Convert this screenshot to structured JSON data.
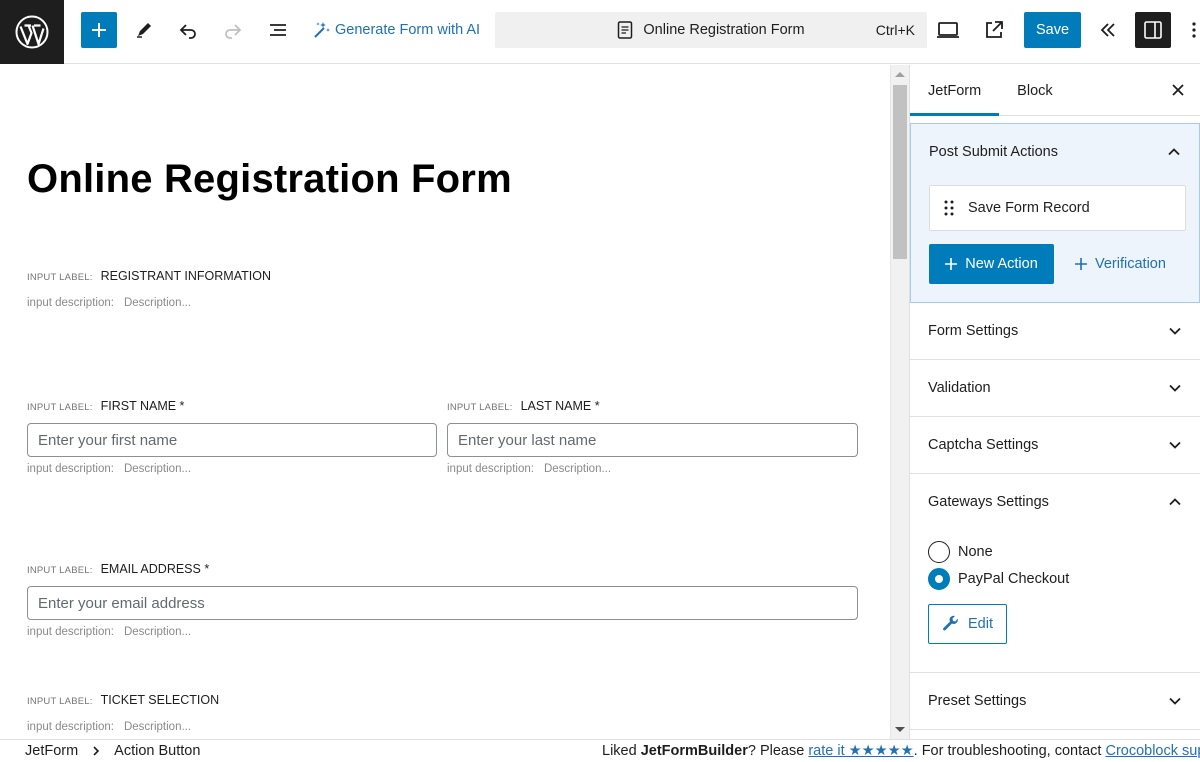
{
  "toolbar": {
    "generate_ai_label": "Generate Form with AI",
    "document_title": "Online Registration Form",
    "shortcut": "Ctrl+K",
    "save_label": "Save",
    "icons": [
      "wordpress-icon",
      "plus-icon",
      "pen-icon",
      "undo-icon",
      "redo-icon",
      "list-view-icon",
      "magic-wand-icon",
      "document-icon",
      "desktop-icon",
      "external-link-icon",
      "collapse-icon",
      "sidebar-icon",
      "more-icon"
    ]
  },
  "canvas": {
    "title": "Online Registration Form",
    "input_label_prefix": "INPUT LABEL:",
    "description_prefix": "input description:",
    "description_placeholder": "Description...",
    "fields": {
      "registrant": {
        "label": "REGISTRANT INFORMATION"
      },
      "first_name": {
        "label": "FIRST NAME *",
        "placeholder": "Enter your first name"
      },
      "last_name": {
        "label": "LAST NAME *",
        "placeholder": "Enter your last name"
      },
      "email": {
        "label": "EMAIL ADDRESS *",
        "placeholder": "Enter your email address"
      },
      "ticket": {
        "label": "TICKET SELECTION"
      }
    }
  },
  "sidebar": {
    "tabs": [
      "JetForm",
      "Block"
    ],
    "active_tab": "JetForm",
    "post_submit": {
      "title": "Post Submit Actions",
      "action_card": "Save Form Record",
      "new_action": "New Action",
      "verification": "Verification"
    },
    "sections": {
      "form_settings": "Form Settings",
      "validation": "Validation",
      "captcha": "Captcha Settings",
      "gateways": "Gateways Settings",
      "preset": "Preset Settings"
    },
    "gateways": {
      "options": [
        "None",
        "PayPal Checkout"
      ],
      "selected": "PayPal Checkout",
      "edit_label": "Edit"
    }
  },
  "footer": {
    "crumb_1": "JetForm",
    "crumb_2": "Action Button",
    "promo_prefix": "Liked ",
    "promo_brand": "JetFormBuilder",
    "promo_mid": "? Please ",
    "promo_link": "rate it ★★★★★",
    "promo_after": ". For troubleshooting, contact ",
    "promo_support": "Crocoblock supp"
  },
  "colors": {
    "accent": "#007cba",
    "link": "#2271b1",
    "dark": "#1e1e1e",
    "panel_highlight": "#eef4fb"
  }
}
